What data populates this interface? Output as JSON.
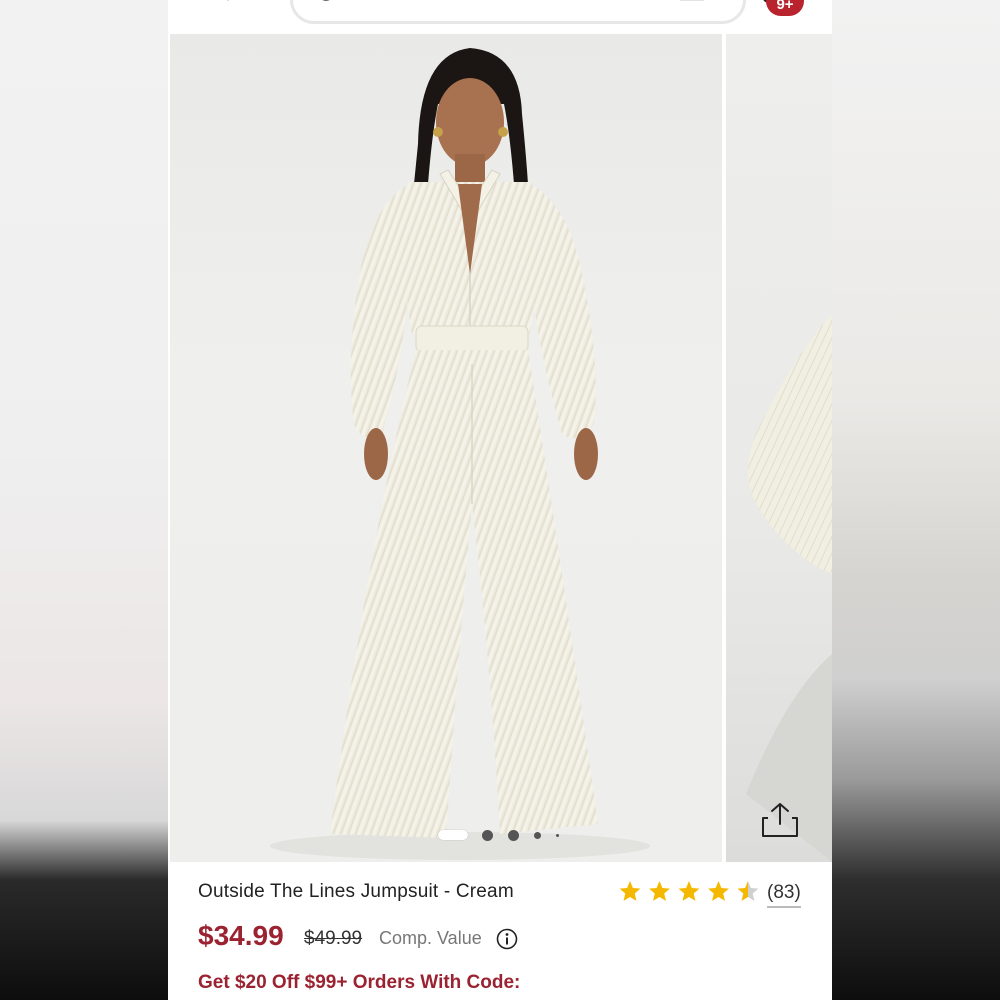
{
  "header": {
    "search_placeholder": "",
    "cart_badge": "9+"
  },
  "gallery": {
    "image_count": 5,
    "active_index": 0
  },
  "product": {
    "title": "Outside The Lines Jumpsuit - Cream",
    "rating": 4.5,
    "rating_max": 5,
    "review_count": "(83)",
    "price": "$34.99",
    "original_price": "$49.99",
    "comp_label": "Comp. Value",
    "promo": "Get $20 Off $99+ Orders With Code:"
  },
  "colors": {
    "accent": "#9b2230",
    "badge": "#b8232d",
    "star": "#f5b800",
    "star_empty": "#d0d0d0"
  }
}
